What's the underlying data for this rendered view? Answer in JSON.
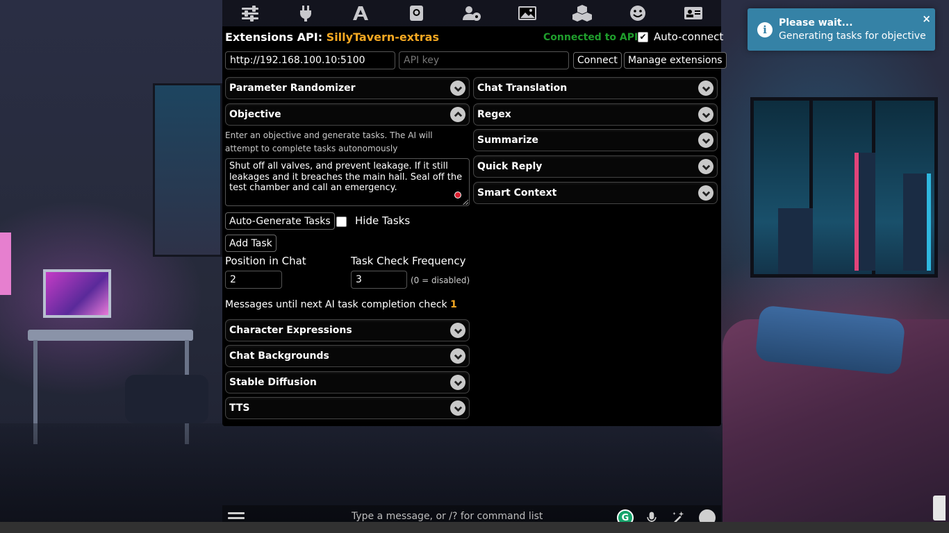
{
  "topbar": {
    "icons": [
      "sliders-icon",
      "plug-icon",
      "font-icon",
      "book-icon",
      "users-gear-icon",
      "image-icon",
      "cubes-icon",
      "smile-icon",
      "id-card-icon"
    ]
  },
  "extensions": {
    "title_prefix": "Extensions API:",
    "title_accent": "SillyTavern-extras",
    "status": "Connected to API",
    "auto_connect_label": "Auto-connect",
    "auto_connect_checked": true,
    "api_url_value": "http://192.168.100.10:5100",
    "api_key_placeholder": "API key",
    "connect_button": "Connect",
    "manage_button": "Manage extensions"
  },
  "left_drawers": {
    "parameter_randomizer": "Parameter Randomizer",
    "objective": "Objective",
    "character_expressions": "Character Expressions",
    "chat_backgrounds": "Chat Backgrounds",
    "stable_diffusion": "Stable Diffusion",
    "tts": "TTS"
  },
  "right_drawers": {
    "chat_translation": "Chat Translation",
    "regex": "Regex",
    "summarize": "Summarize",
    "quick_reply": "Quick Reply",
    "smart_context": "Smart Context"
  },
  "objective": {
    "description": "Enter an objective and generate tasks. The AI will attempt to complete tasks autonomously",
    "text": "Shut off all valves, and prevent leakage. If it still leakages and it breaches the main hall. Seal off the test chamber and call an emergency.",
    "auto_generate_button": "Auto-Generate Tasks",
    "hide_tasks_label": "Hide Tasks",
    "hide_tasks_checked": false,
    "add_task_button": "Add Task",
    "position_label": "Position in Chat",
    "position_value": "2",
    "frequency_label": "Task Check Frequency",
    "frequency_value": "3",
    "frequency_hint": "(0 = disabled)",
    "messages_until_label": "Messages until next AI task completion check",
    "messages_until_value": "1"
  },
  "toast": {
    "title": "Please wait...",
    "message": "Generating tasks for objective",
    "close": "×"
  },
  "sendbar": {
    "placeholder": "Type a message, or /? for command list",
    "grammarly_letter": "G"
  },
  "colors": {
    "accent": "#f4a822",
    "connected": "#1f9d2c",
    "toast_bg": "#3582a6"
  }
}
